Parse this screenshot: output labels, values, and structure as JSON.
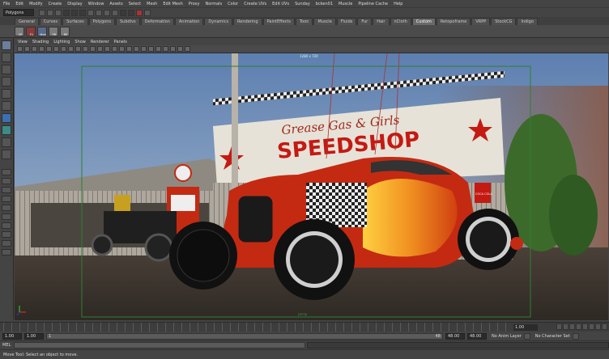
{
  "menubar": {
    "items": [
      "File",
      "Edit",
      "Modify",
      "Create",
      "Display",
      "Window",
      "Assets",
      "Select",
      "Mesh",
      "Edit Mesh",
      "Proxy",
      "Normals",
      "Color",
      "Create UVs",
      "Edit UVs",
      "Sunday",
      "bcken01",
      "Muscle",
      "Pipeline Cache",
      "Help"
    ]
  },
  "statusline": {
    "mode": "Polygons"
  },
  "shelf": {
    "tabs": [
      "General",
      "Curves",
      "Surfaces",
      "Polygons",
      "Subdivs",
      "Deformation",
      "Animation",
      "Dynamics",
      "Rendering",
      "PaintEffects",
      "Toon",
      "Muscle",
      "Fluids",
      "Fur",
      "Hair",
      "nCloth",
      "Custom",
      "Retopoframe",
      "VRPP",
      "StockCG",
      "Indigo"
    ],
    "active_tab": "Custom",
    "icon_labels": [
      "CP",
      "F1",
      "Mod",
      "FR",
      "RE"
    ]
  },
  "panel": {
    "menus": [
      "View",
      "Shading",
      "Lighting",
      "Show",
      "Renderer",
      "Panels"
    ],
    "resolution": "1280 x 720",
    "camera": "persp"
  },
  "scene": {
    "sign_line1": "Grease Gas & Girls",
    "sign_line2": "SPEEDSHOP",
    "side_sign": "COCA COLA"
  },
  "timeslider": {
    "current": "1.00"
  },
  "rangeslider": {
    "start": "1.00",
    "start2": "1.00",
    "range_start": "1",
    "range_end": "48",
    "end": "48.00",
    "end2": "48.00",
    "anim_layer": "No Anim Layer",
    "char_set": "No Character Set"
  },
  "cmdline": {
    "label": "MEL"
  },
  "helpline": {
    "text": "Move Tool: Select an object to move."
  },
  "colors": {
    "sky": "#6d8bb4",
    "ground": "#3a3530",
    "car_red": "#c42a12",
    "flame_yellow": "#f0b020"
  }
}
